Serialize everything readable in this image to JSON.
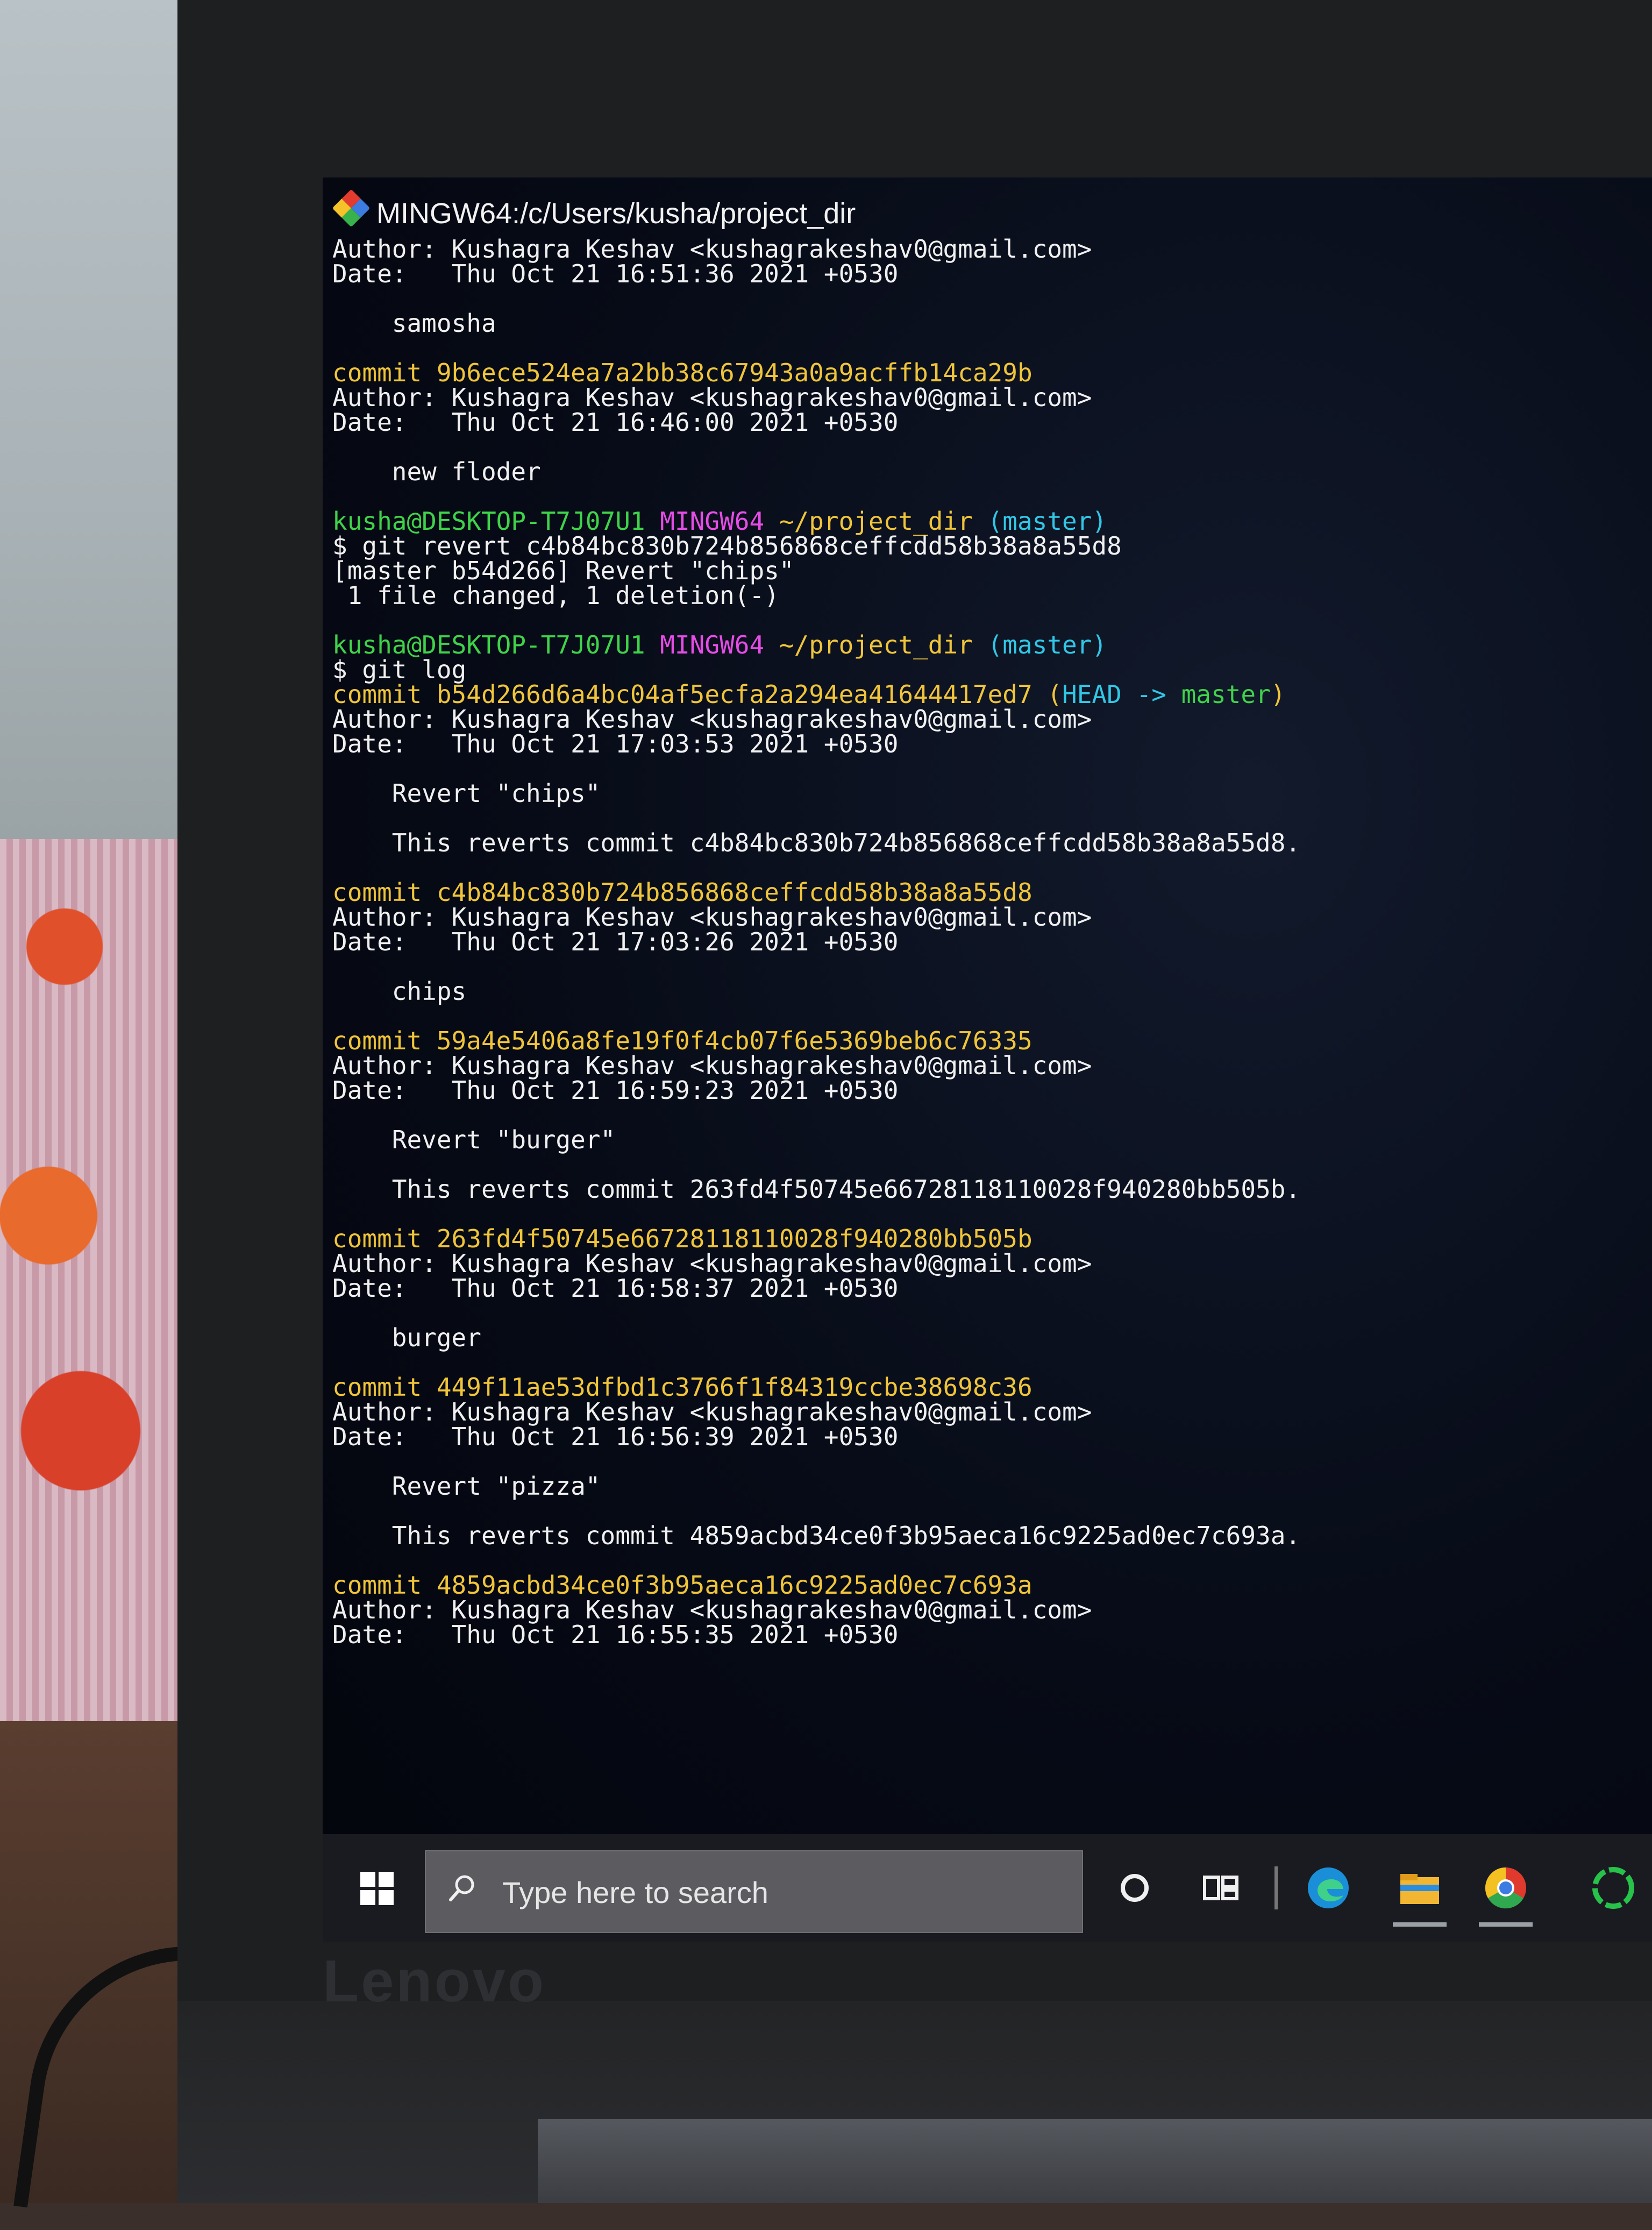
{
  "window": {
    "title": "MINGW64:/c/Users/kusha/project_dir"
  },
  "terminal": {
    "lines": [
      [
        {
          "t": "Author: Kushagra Keshav <kushagrakeshav0@gmail.com>",
          "c": "white"
        }
      ],
      [
        {
          "t": "Date:   Thu Oct 21 16:51:36 2021 +0530",
          "c": "white"
        }
      ],
      [],
      [
        {
          "t": "    samosha",
          "c": "white"
        }
      ],
      [],
      [
        {
          "t": "commit 9b6ece524ea7a2bb38c67943a0a9acffb14ca29b",
          "c": "yellow"
        }
      ],
      [
        {
          "t": "Author: Kushagra Keshav <kushagrakeshav0@gmail.com>",
          "c": "white"
        }
      ],
      [
        {
          "t": "Date:   Thu Oct 21 16:46:00 2021 +0530",
          "c": "white"
        }
      ],
      [],
      [
        {
          "t": "    new floder",
          "c": "white"
        }
      ],
      [],
      [
        {
          "t": "kusha@DESKTOP-T7J07U1 ",
          "c": "green"
        },
        {
          "t": "MINGW64 ",
          "c": "magenta"
        },
        {
          "t": "~/project_dir ",
          "c": "yellow"
        },
        {
          "t": "(master)",
          "c": "cyan"
        }
      ],
      [
        {
          "t": "$ git revert c4b84bc830b724b856868ceffcdd58b38a8a55d8",
          "c": "white"
        }
      ],
      [
        {
          "t": "[master b54d266] Revert \"chips\"",
          "c": "white"
        }
      ],
      [
        {
          "t": " 1 file changed, 1 deletion(-)",
          "c": "white"
        }
      ],
      [],
      [
        {
          "t": "kusha@DESKTOP-T7J07U1 ",
          "c": "green"
        },
        {
          "t": "MINGW64 ",
          "c": "magenta"
        },
        {
          "t": "~/project_dir ",
          "c": "yellow"
        },
        {
          "t": "(master)",
          "c": "cyan"
        }
      ],
      [
        {
          "t": "$ git log",
          "c": "white"
        }
      ],
      [
        {
          "t": "commit b54d266d6a4bc04af5ecfa2a294ea41644417ed7 ",
          "c": "yellow"
        },
        {
          "t": "(",
          "c": "yellow"
        },
        {
          "t": "HEAD -> ",
          "c": "cyan"
        },
        {
          "t": "master",
          "c": "green"
        },
        {
          "t": ")",
          "c": "yellow"
        }
      ],
      [
        {
          "t": "Author: Kushagra Keshav <kushagrakeshav0@gmail.com>",
          "c": "white"
        }
      ],
      [
        {
          "t": "Date:   Thu Oct 21 17:03:53 2021 +0530",
          "c": "white"
        }
      ],
      [],
      [
        {
          "t": "    Revert \"chips\"",
          "c": "white"
        }
      ],
      [],
      [
        {
          "t": "    This reverts commit c4b84bc830b724b856868ceffcdd58b38a8a55d8.",
          "c": "white"
        }
      ],
      [],
      [
        {
          "t": "commit c4b84bc830b724b856868ceffcdd58b38a8a55d8",
          "c": "yellow"
        }
      ],
      [
        {
          "t": "Author: Kushagra Keshav <kushagrakeshav0@gmail.com>",
          "c": "white"
        }
      ],
      [
        {
          "t": "Date:   Thu Oct 21 17:03:26 2021 +0530",
          "c": "white"
        }
      ],
      [],
      [
        {
          "t": "    chips",
          "c": "white"
        }
      ],
      [],
      [
        {
          "t": "commit 59a4e5406a8fe19f0f4cb07f6e5369beb6c76335",
          "c": "yellow"
        }
      ],
      [
        {
          "t": "Author: Kushagra Keshav <kushagrakeshav0@gmail.com>",
          "c": "white"
        }
      ],
      [
        {
          "t": "Date:   Thu Oct 21 16:59:23 2021 +0530",
          "c": "white"
        }
      ],
      [],
      [
        {
          "t": "    Revert \"burger\"",
          "c": "white"
        }
      ],
      [],
      [
        {
          "t": "    This reverts commit 263fd4f50745e66728118110028f940280bb505b.",
          "c": "white"
        }
      ],
      [],
      [
        {
          "t": "commit 263fd4f50745e66728118110028f940280bb505b",
          "c": "yellow"
        }
      ],
      [
        {
          "t": "Author: Kushagra Keshav <kushagrakeshav0@gmail.com>",
          "c": "white"
        }
      ],
      [
        {
          "t": "Date:   Thu Oct 21 16:58:37 2021 +0530",
          "c": "white"
        }
      ],
      [],
      [
        {
          "t": "    burger",
          "c": "white"
        }
      ],
      [],
      [
        {
          "t": "commit 449f11ae53dfbd1c3766f1f84319ccbe38698c36",
          "c": "yellow"
        }
      ],
      [
        {
          "t": "Author: Kushagra Keshav <kushagrakeshav0@gmail.com>",
          "c": "white"
        }
      ],
      [
        {
          "t": "Date:   Thu Oct 21 16:56:39 2021 +0530",
          "c": "white"
        }
      ],
      [],
      [
        {
          "t": "    Revert \"pizza\"",
          "c": "white"
        }
      ],
      [],
      [
        {
          "t": "    This reverts commit 4859acbd34ce0f3b95aeca16c9225ad0ec7c693a.",
          "c": "white"
        }
      ],
      [],
      [
        {
          "t": "commit 4859acbd34ce0f3b95aeca16c9225ad0ec7c693a",
          "c": "yellow"
        }
      ],
      [
        {
          "t": "Author: Kushagra Keshav <kushagrakeshav0@gmail.com>",
          "c": "white"
        }
      ],
      [
        {
          "t": "Date:   Thu Oct 21 16:55:35 2021 +0530",
          "c": "white"
        }
      ]
    ]
  },
  "taskbar": {
    "search_placeholder": "Type here to search",
    "icons": [
      "windows-start-icon",
      "search-icon",
      "cortana-icon",
      "task-view-icon",
      "edge-icon",
      "file-explorer-icon",
      "chrome-icon",
      "app-icon"
    ]
  },
  "laptop": {
    "brand": "Lenovo"
  },
  "colors": {
    "yellow": "#f0c53a",
    "green": "#3fd34a",
    "magenta": "#e64ce6",
    "cyan": "#31c7e6",
    "white": "#f0f0f0"
  }
}
